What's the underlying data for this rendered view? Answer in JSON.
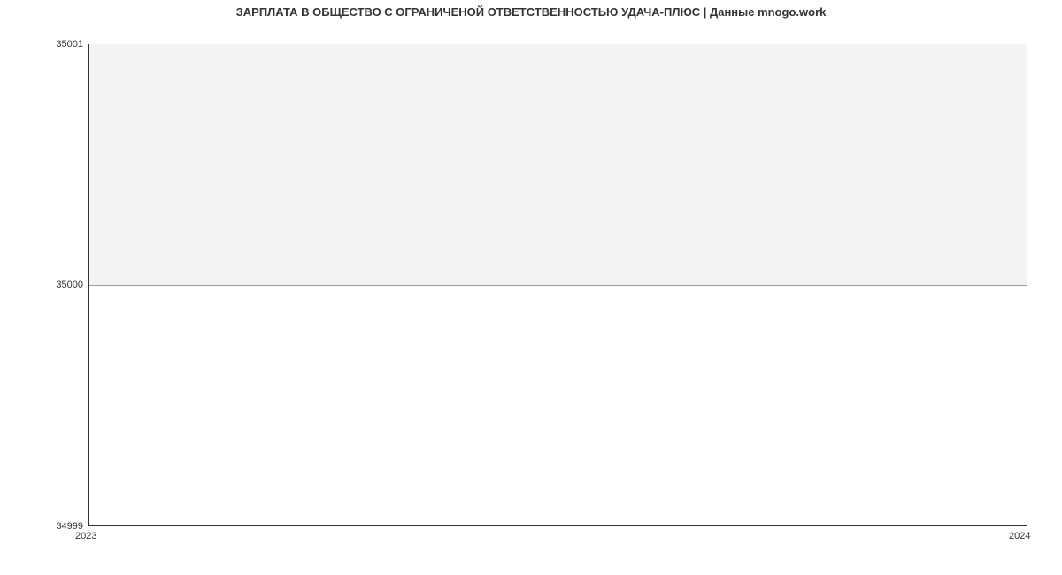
{
  "chart_data": {
    "type": "area",
    "title": "ЗАРПЛАТА В ОБЩЕСТВО С ОГРАНИЧЕНОЙ ОТВЕТСТВЕННОСТЬЮ УДАЧА-ПЛЮС | Данные mnogo.work",
    "x": [
      2023,
      2024
    ],
    "y": [
      35000,
      35000
    ],
    "xlabel": "",
    "ylabel": "",
    "xlim": [
      2023,
      2024
    ],
    "ylim": [
      34999,
      35001
    ],
    "xticks": [
      "2023",
      "2024"
    ],
    "yticks": [
      "35001",
      "35000",
      "34999"
    ],
    "line_color": "#6aa9e9",
    "fill_color": "#f3f3f3"
  }
}
